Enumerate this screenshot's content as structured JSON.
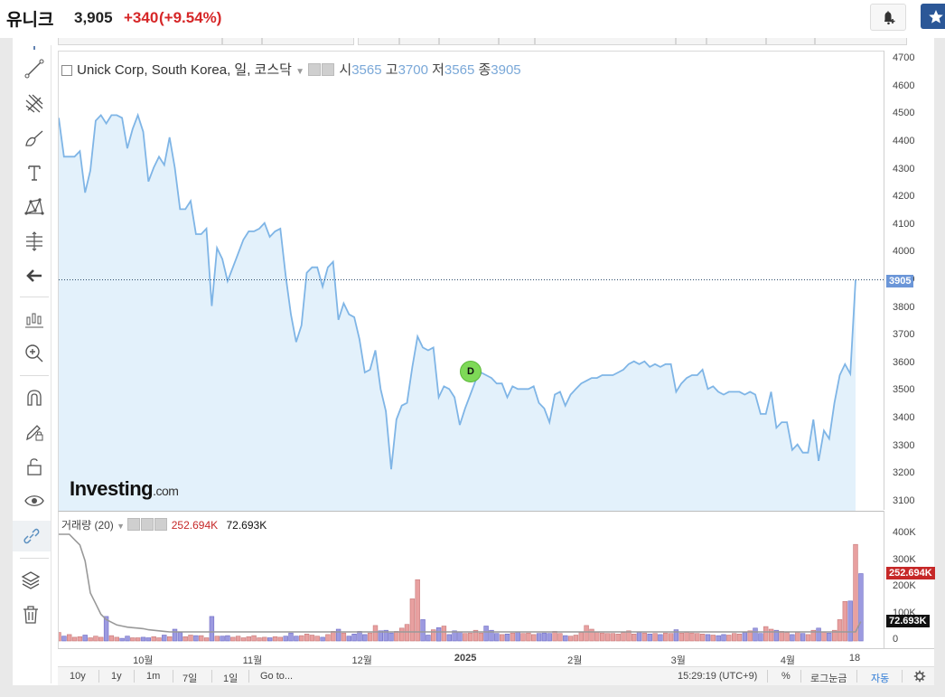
{
  "header": {
    "symbol": "유니크",
    "price": "3,905",
    "change": "+340",
    "change_pct": "(+9.54%)"
  },
  "legend": {
    "title": "Unick Corp, South Korea, 일, 코스닥",
    "open_label": "시",
    "open": "3565",
    "high_label": "고",
    "high": "3700",
    "low_label": "저",
    "low": "3565",
    "close_label": "종",
    "close": "3905"
  },
  "volume_legend": {
    "label": "거래량 (20)",
    "value1": "252.694K",
    "value2": "72.693K"
  },
  "marker": {
    "letter": "D"
  },
  "logo": {
    "brand": "Investing",
    "suffix": ".com"
  },
  "badges": {
    "price": "3905",
    "volume": "252.694K",
    "volume_ma": "72.693K"
  },
  "bottom_bar": {
    "ranges": [
      "10y",
      "1y",
      "1m",
      "7일",
      "1일"
    ],
    "goto": "Go to...",
    "time": "15:29:19 (UTC+9)",
    "percent": "%",
    "log": "로그눈금",
    "auto": "자동"
  },
  "colors": {
    "line": "#7fb5e6",
    "area": "#e3f1fb",
    "up": "#e8a0a0",
    "down": "#9c9ae0",
    "ma": "#999999",
    "accent": "#2b5797"
  },
  "icons": [
    "cursor-icon",
    "trend-line-icon",
    "fib-icon",
    "brush-icon",
    "text-icon",
    "pattern-icon",
    "measure-icon",
    "back-arrow-icon",
    "indicators-icon",
    "zoom-icon",
    "magnet-icon",
    "pencil-lock-icon",
    "lock-icon",
    "eye-icon",
    "link-icon",
    "layers-icon",
    "trash-icon",
    "gear-icon",
    "add-alert-icon",
    "star-icon"
  ],
  "chart_data": [
    {
      "type": "line",
      "title": "Unick Corp, South Korea, 일, 코스닥",
      "xlabel": "",
      "ylabel": "",
      "ylim": [
        3070,
        4730
      ],
      "y_ticks": [
        3100,
        3200,
        3300,
        3400,
        3500,
        3600,
        3700,
        3800,
        3900,
        4000,
        4100,
        4200,
        4300,
        4400,
        4500,
        4600,
        4700
      ],
      "x_tick_labels": [
        "10월",
        "11월",
        "12월",
        "2025",
        "2월",
        "3월",
        "4월",
        "18"
      ],
      "x_tick_index": [
        14,
        32,
        50,
        67,
        85,
        102,
        120,
        131
      ],
      "last_price_line": 3905,
      "values": [
        4490,
        4350,
        4350,
        4350,
        4370,
        4220,
        4300,
        4480,
        4500,
        4470,
        4500,
        4500,
        4490,
        4380,
        4450,
        4500,
        4440,
        4260,
        4310,
        4350,
        4320,
        4420,
        4310,
        4160,
        4160,
        4190,
        4070,
        4070,
        4090,
        3810,
        4020,
        3980,
        3900,
        3950,
        4000,
        4050,
        4080,
        4080,
        4090,
        4110,
        4060,
        4080,
        4090,
        3920,
        3780,
        3680,
        3740,
        3930,
        3950,
        3950,
        3880,
        3950,
        3970,
        3760,
        3820,
        3780,
        3770,
        3690,
        3570,
        3580,
        3650,
        3510,
        3430,
        3220,
        3400,
        3450,
        3460,
        3590,
        3700,
        3660,
        3650,
        3660,
        3480,
        3520,
        3510,
        3480,
        3380,
        3440,
        3490,
        3540,
        3570,
        3560,
        3550,
        3530,
        3530,
        3480,
        3520,
        3510,
        3510,
        3510,
        3520,
        3460,
        3440,
        3390,
        3490,
        3500,
        3450,
        3490,
        3510,
        3530,
        3540,
        3550,
        3550,
        3560,
        3560,
        3560,
        3570,
        3580,
        3600,
        3610,
        3600,
        3610,
        3590,
        3600,
        3590,
        3600,
        3600,
        3500,
        3530,
        3550,
        3560,
        3560,
        3580,
        3510,
        3520,
        3500,
        3490,
        3500,
        3500,
        3500,
        3490,
        3500,
        3490,
        3420,
        3420,
        3500,
        3370,
        3390,
        3390,
        3290,
        3310,
        3280,
        3280,
        3400,
        3250,
        3360,
        3330,
        3460,
        3560,
        3600,
        3565,
        3905
      ]
    },
    {
      "type": "bar",
      "title": "거래량 (20)",
      "ylim": [
        0,
        400
      ],
      "y_ticks": [
        "0",
        "100K",
        "200K",
        "300K",
        "400K"
      ],
      "unit": "K",
      "values": [
        32,
        18,
        24,
        14,
        16,
        22,
        12,
        18,
        14,
        92,
        20,
        14,
        10,
        18,
        12,
        12,
        14,
        12,
        16,
        12,
        22,
        16,
        44,
        32,
        16,
        22,
        20,
        20,
        12,
        92,
        18,
        18,
        20,
        14,
        18,
        12,
        16,
        20,
        12,
        14,
        12,
        16,
        14,
        18,
        30,
        18,
        20,
        26,
        22,
        18,
        14,
        24,
        36,
        44,
        30,
        18,
        26,
        36,
        24,
        30,
        58,
        38,
        40,
        30,
        36,
        48,
        62,
        158,
        230,
        80,
        22,
        42,
        50,
        56,
        24,
        38,
        34,
        28,
        30,
        40,
        30,
        56,
        40,
        28,
        24,
        26,
        30,
        34,
        28,
        30,
        24,
        28,
        30,
        28,
        36,
        28,
        20,
        18,
        22,
        32,
        58,
        44,
        34,
        30,
        28,
        28,
        26,
        32,
        38,
        26,
        34,
        30,
        26,
        28,
        24,
        30,
        28,
        42,
        30,
        34,
        30,
        28,
        26,
        24,
        22,
        20,
        24,
        22,
        28,
        26,
        32,
        38,
        48,
        28,
        54,
        44,
        40,
        36,
        32,
        24,
        34,
        28,
        24,
        40,
        48,
        34,
        30,
        40,
        80,
        148,
        150,
        362,
        252.694
      ],
      "ma_values": [
        400,
        400,
        400,
        380,
        360,
        300,
        180,
        140,
        100,
        80,
        70,
        60,
        56,
        52,
        50,
        48,
        46,
        42,
        40,
        38,
        36,
        34,
        34,
        34,
        34,
        34,
        34,
        34,
        34,
        34,
        34,
        34,
        34,
        34,
        34,
        34,
        34,
        34,
        34,
        34,
        34,
        34,
        34,
        34,
        34,
        34,
        34,
        34,
        34,
        34,
        34,
        34,
        34,
        34,
        34,
        34,
        34,
        34,
        34,
        34,
        34,
        34,
        34,
        34,
        34,
        34,
        34,
        34,
        34,
        34,
        34,
        34,
        34,
        34,
        34,
        34,
        34,
        34,
        34,
        34,
        34,
        34,
        34,
        34,
        34,
        34,
        34,
        34,
        34,
        34,
        34,
        34,
        34,
        34,
        34,
        34,
        34,
        34,
        34,
        34,
        34,
        34,
        34,
        34,
        34,
        34,
        34,
        34,
        34,
        34,
        34,
        34,
        34,
        34,
        34,
        34,
        34,
        34,
        34,
        34,
        34,
        34,
        34,
        34,
        34,
        34,
        34,
        34,
        34,
        34,
        34,
        34,
        34,
        34,
        34,
        34,
        34,
        34,
        34,
        34,
        34,
        34,
        34,
        34,
        34,
        34,
        34,
        34,
        34,
        34,
        34,
        34,
        72.693
      ]
    }
  ]
}
